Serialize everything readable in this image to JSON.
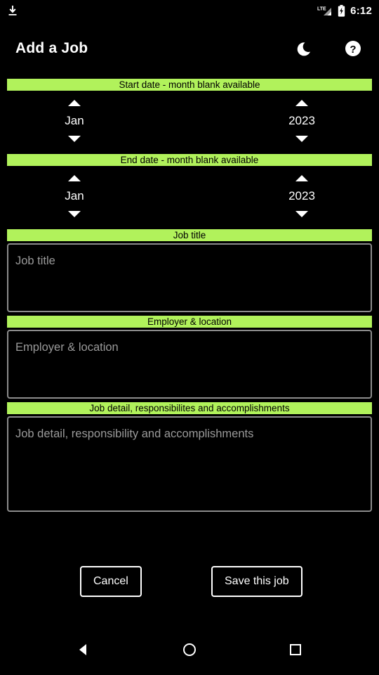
{
  "statusbar": {
    "download_icon": "download-icon",
    "network_label": "LTE",
    "signal_icon": "signal-bars-icon",
    "battery_icon": "battery-charging-icon",
    "time": "6:12"
  },
  "appbar": {
    "title": "Add a Job",
    "dark_mode_icon": "moon-icon",
    "help_icon": "help-circle-icon"
  },
  "theme": {
    "accent": "#b1f25b",
    "background": "#000000",
    "text": "#ffffff",
    "placeholder": "#9a9a9a",
    "field_border": "#8c8c8c"
  },
  "form": {
    "start_date": {
      "label": "Start date - month blank available",
      "month": "Jan",
      "year": "2023",
      "month_up_icon": "arrow-up-icon",
      "month_down_icon": "arrow-down-icon",
      "year_up_icon": "arrow-up-icon",
      "year_down_icon": "arrow-down-icon"
    },
    "end_date": {
      "label": "End date - month blank available",
      "month": "Jan",
      "year": "2023",
      "month_up_icon": "arrow-up-icon",
      "month_down_icon": "arrow-down-icon",
      "year_up_icon": "arrow-up-icon",
      "year_down_icon": "arrow-down-icon"
    },
    "job_title": {
      "label": "Job title",
      "placeholder": "Job title",
      "value": ""
    },
    "employer": {
      "label": "Employer & location",
      "placeholder": "Employer & location",
      "value": ""
    },
    "job_detail": {
      "label": "Job detail, responsibilites and accomplishments",
      "placeholder": "Job detail, responsibility and accomplishments",
      "value": ""
    }
  },
  "actions": {
    "cancel_label": "Cancel",
    "save_label": "Save this job"
  },
  "navbar": {
    "back_icon": "back-triangle-icon",
    "home_icon": "home-circle-icon",
    "recents_icon": "recents-square-icon"
  }
}
